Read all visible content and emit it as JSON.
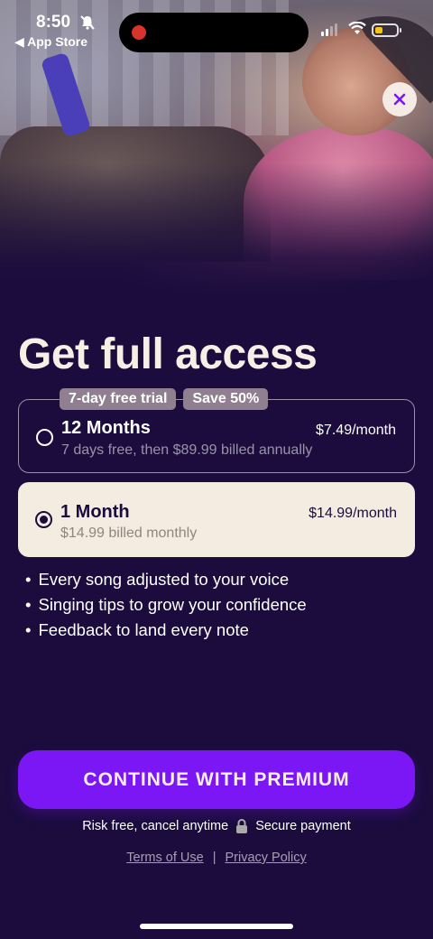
{
  "status_bar": {
    "time": "8:50",
    "back_label": "◀ App Store"
  },
  "hero": {
    "image": "woman-singing-with-earphones-on-couch"
  },
  "close_icon": "×",
  "title": "Get full access",
  "badges": [
    "7-day free trial",
    "Save 50%"
  ],
  "plans": [
    {
      "name": "12 Months",
      "subtitle": "7 days free, then $89.99 billed annually",
      "price": "$7.49/month",
      "selected": false
    },
    {
      "name": "1 Month",
      "subtitle": "$14.99 billed monthly",
      "price": "$14.99/month",
      "selected": true
    }
  ],
  "features": [
    "Every song adjusted to your voice",
    "Singing tips to grow your confidence",
    "Feedback to land every note"
  ],
  "cta_label": "CONTINUE WITH PREMIUM",
  "trust": {
    "left": "Risk free, cancel anytime",
    "right": "Secure payment"
  },
  "links": {
    "terms": "Terms of Use",
    "separator": "|",
    "privacy": "Privacy Policy"
  },
  "colors": {
    "background": "#1b0c3d",
    "cta": "#7b16f5",
    "selected_card": "#f4ece0",
    "badge": "#8f7f90"
  }
}
